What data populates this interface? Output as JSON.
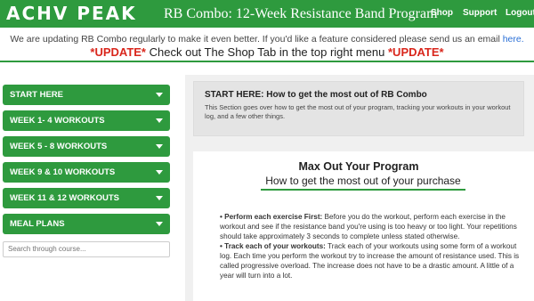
{
  "header": {
    "logo": "ACHV PEAK",
    "title": "RB Combo: 12-Week Resistance Band Program",
    "nav": [
      "Shop",
      "Support",
      "Logout"
    ]
  },
  "notice": {
    "text": "We are updating RB Combo regularly to make it even better. If you'd like a feature considered please send us an email",
    "link": "here.",
    "update_tag_left": "*UPDATE*",
    "update_text": "Check out The Shop Tab in the top right menu",
    "update_tag_right": "*UPDATE*"
  },
  "sidebar": {
    "sections": [
      "START HERE",
      "WEEK 1- 4 WORKOUTS",
      "WEEK 5 - 8 WORKOUTS",
      "WEEK 9 & 10 WORKOUTS",
      "WEEK 11 & 12 WORKOUTS",
      "MEAL PLANS"
    ],
    "search_placeholder": "Search through course..."
  },
  "main": {
    "card_title": "START HERE: How to get the most out of RB Combo",
    "card_desc": "This Section goes over how to get the most out of your program, tracking your workouts in your workout log, and a few other things.",
    "heading": "Max Out Your Program",
    "subheading": "How to get the most out of your purchase",
    "bullets": [
      {
        "lead": "• Perform each exercise First:",
        "text": " Before you do the workout, perform each exercise in the workout and see if the resistance band you're using is too heavy or too light. Your repetitions should take approximately 3 seconds to complete unless stated otherwise."
      },
      {
        "lead": "• Track each of your workouts:",
        "text": " Track each of your workouts using some form of a workout log. Each time you perform the workout try to increase the amount of resistance used. This is called progressive overload. The increase does not have to be a drastic amount. A little of a year will turn into a lot."
      }
    ]
  },
  "colors": {
    "brand_green": "#2e9a3e",
    "update_red": "#d9261c",
    "link_blue": "#2a6fd6"
  }
}
